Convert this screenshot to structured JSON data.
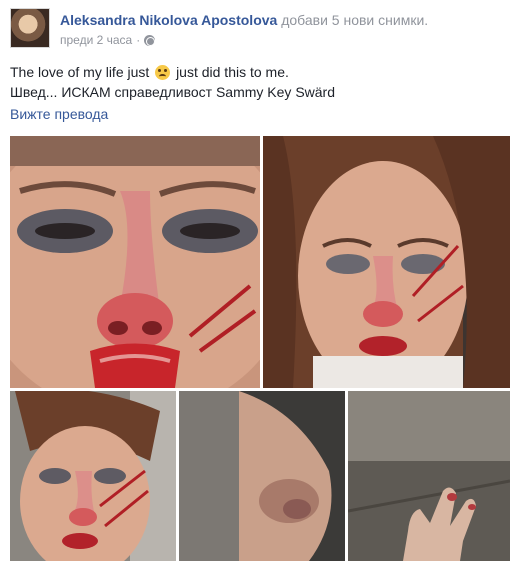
{
  "post": {
    "author": "Aleksandra Nikolova Apostolova",
    "action": "добави 5 нови снимки.",
    "timestamp": "преди 2 часа",
    "separator": "·",
    "privacy_icon": "globe-icon",
    "text_line1_before": "The love of my life just",
    "text_emoji": "crying-face-icon",
    "text_line1_after": "just did this to me.",
    "text_line2": "Швед... ИСКАМ справедливост Sammy Key Swärd",
    "translate_link": "Вижте превода"
  },
  "photos": {
    "count": 5,
    "colors": {
      "skin": "#d9a48a",
      "blood": "#c8252b",
      "hair": "#6b3f2a",
      "background_dark": "#3b3a38"
    }
  }
}
